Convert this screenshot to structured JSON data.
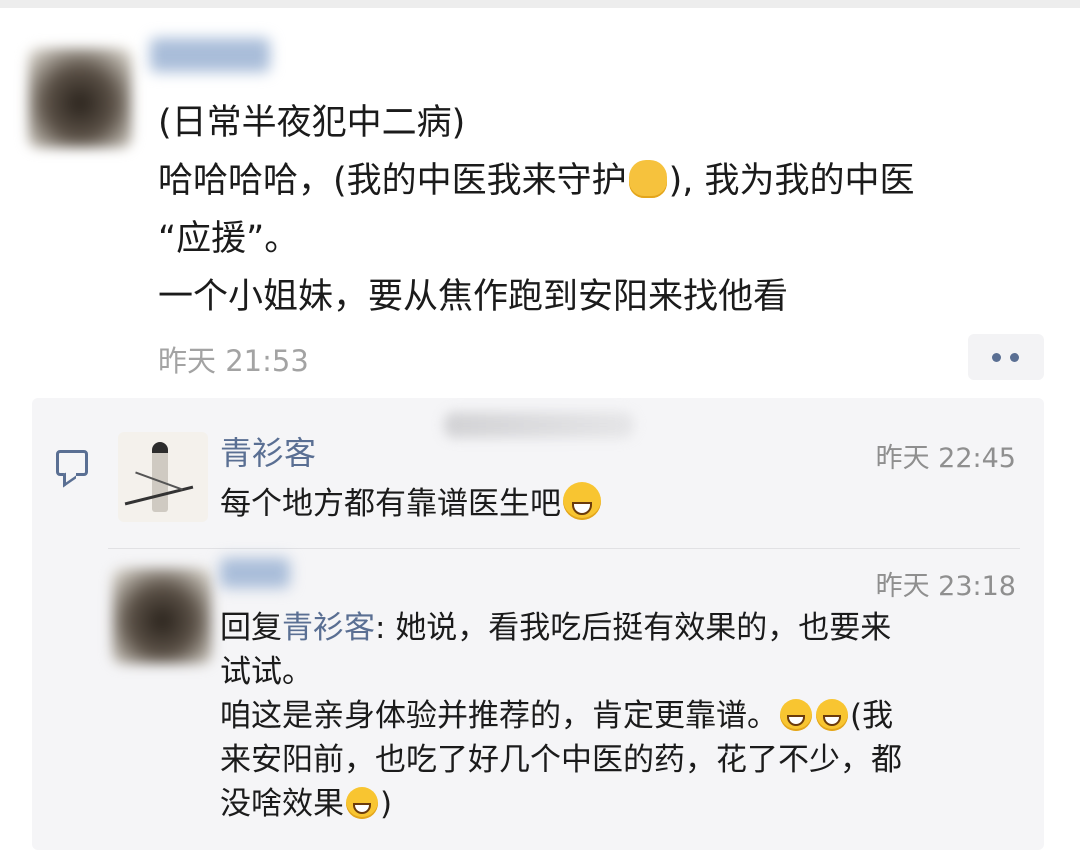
{
  "post": {
    "author": "用户",
    "lines": [
      "(日常半夜犯中二病)",
      "哈哈哈哈，(我的中医我来守护",
      "), 我为我的中医",
      "“应援”。",
      "一个小姐妹，要从焦作跑到安阳来找他看"
    ],
    "time": "昨天 21:53"
  },
  "comments": [
    {
      "author": "青衫客",
      "time": "昨天 22:45",
      "text": "每个地方都有靠谱医生吧"
    },
    {
      "author": "用户",
      "time": "昨天 23:18",
      "reply_prefix": "回复",
      "reply_to": "青衫客",
      "reply_colon": ": ",
      "line1": "她说，看我吃后挺有效果的，也要来",
      "line2": "试试。",
      "line3a": "咱这是亲身体验并推荐的，肯定更靠谱。",
      "line3b": "(我",
      "line4": "来安阳前，也吃了好几个中医的药，花了不少，都",
      "line5a": "没啥效果",
      "line5b": ")"
    }
  ],
  "icons": {
    "emoji_fist": "raised-fist-emoji",
    "emoji_laugh": "laughing-tears-emoji",
    "emoji_grin": "grinning-emoji",
    "emoji_cry": "crying-laugh-emoji",
    "comment": "comment-icon",
    "more": "more-dots-icon"
  },
  "colors": {
    "link": "#5a6f93",
    "time": "#a3a3a3",
    "comment_bg": "#f5f5f7"
  }
}
